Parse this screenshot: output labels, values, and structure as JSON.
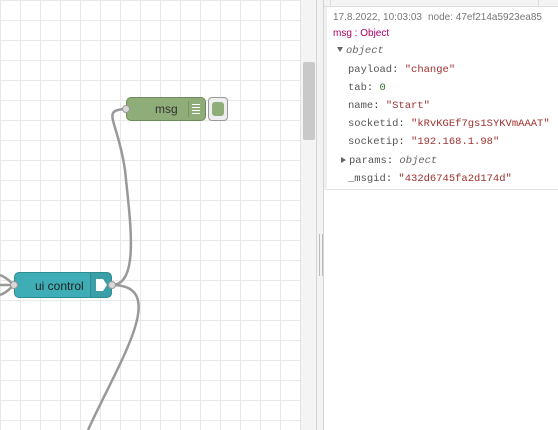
{
  "flow": {
    "msg_node_label": "msg",
    "ui_node_label": "ui control"
  },
  "debug": {
    "timestamp": "17.8.2022, 10:03:03",
    "node_info": "node: 47ef214a5923ea85",
    "msg_type": "msg : Object",
    "root_label": "object",
    "props": [
      {
        "key": "payload",
        "value": "\"change\"",
        "kind": "str"
      },
      {
        "key": "tab",
        "value": "0",
        "kind": "num"
      },
      {
        "key": "name",
        "value": "\"Start\"",
        "kind": "str"
      },
      {
        "key": "socketid",
        "value": "\"kRvKGEf7gs1SYKVmAAAT\"",
        "kind": "str"
      },
      {
        "key": "socketip",
        "value": "\"192.168.1.98\"",
        "kind": "str"
      },
      {
        "key": "params",
        "value": "object",
        "kind": "obj"
      },
      {
        "key": "_msgid",
        "value": "\"432d6745fa2d174d\"",
        "kind": "str"
      }
    ]
  },
  "colors": {
    "msg_node": "#8fad79",
    "ui_node": "#3fadb5",
    "wire": "#999999"
  }
}
